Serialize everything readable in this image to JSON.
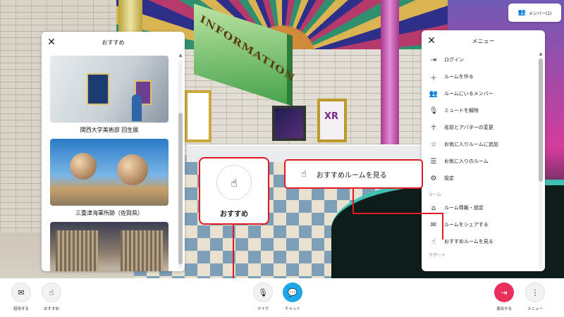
{
  "scene": {
    "information_sign": "INFORMATION",
    "panel_c_text": "XR"
  },
  "members_button": {
    "label": "メンバー(1)",
    "icon": "people-icon"
  },
  "recommend_panel": {
    "title": "おすすめ",
    "items": [
      {
        "title": "関西大学美術部 回生展"
      },
      {
        "title": "三重津海軍所跡（佐賀県）"
      },
      {
        "title": ""
      }
    ]
  },
  "menu_panel": {
    "title": "メニュー",
    "items": [
      {
        "label": "ログイン",
        "icon": "login-icon"
      },
      {
        "label": "ルームを作る",
        "icon": "plus-icon"
      },
      {
        "label": "ルームにいるメンバー",
        "icon": "people-icon"
      },
      {
        "label": "ミュートを解除",
        "icon": "mic-off-icon"
      },
      {
        "label": "名前とアバターの変更",
        "icon": "avatar-icon"
      },
      {
        "label": "お気に入りルームに追加",
        "icon": "star-icon"
      },
      {
        "label": "お気に入りのルーム",
        "icon": "list-icon"
      },
      {
        "label": "設定",
        "icon": "gear-icon"
      }
    ],
    "section_room": "ルーム",
    "room_items": [
      {
        "label": "ルーム情報・設定",
        "icon": "home-icon"
      },
      {
        "label": "ルームをシェアする",
        "icon": "mail-icon"
      },
      {
        "label": "おすすめルームを見る",
        "icon": "hand-pointer-icon"
      }
    ],
    "section_support": "サポート"
  },
  "callouts": {
    "card_label": "おすすめ",
    "bar_label": "おすすめルームを見る"
  },
  "toolbar": {
    "invite_label": "招待する",
    "recommend_label": "おすすめ",
    "mic_label": "マイク",
    "chat_label": "チャット",
    "exit_label": "退出する",
    "menu_label": "メニュー"
  },
  "colors": {
    "accent_red": "#e11b24",
    "chat_blue": "#1ea7e8",
    "exit_red": "#ea2f5c"
  }
}
